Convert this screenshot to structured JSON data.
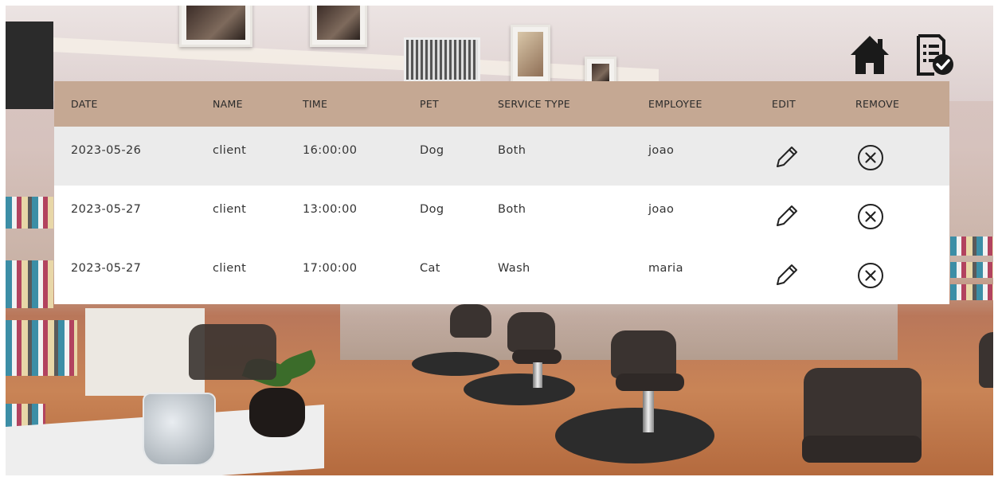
{
  "nav": {
    "home_icon": "home-icon",
    "appointments_icon": "appointment-list-check-icon"
  },
  "colors": {
    "header_bg": "#c5a893",
    "row_odd_bg": "#ebebeb",
    "row_even_bg": "#ffffff",
    "text": "#333333"
  },
  "table": {
    "columns": [
      "DATE",
      "NAME",
      "TIME",
      "PET",
      "SERVICE TYPE",
      "EMPLOYEE",
      "EDIT",
      "REMOVE"
    ],
    "rows": [
      {
        "date": "2023-05-26",
        "name": "client",
        "time": "16:00:00",
        "pet": "Dog",
        "service": "Both",
        "employee": "joao",
        "edit_icon": "pencil-icon",
        "remove_icon": "circle-x-icon"
      },
      {
        "date": "2023-05-27",
        "name": "client",
        "time": "13:00:00",
        "pet": "Dog",
        "service": "Both",
        "employee": "joao",
        "edit_icon": "pencil-icon",
        "remove_icon": "circle-x-icon"
      },
      {
        "date": "2023-05-27",
        "name": "client",
        "time": "17:00:00",
        "pet": "Cat",
        "service": "Wash",
        "employee": "maria",
        "edit_icon": "pencil-icon",
        "remove_icon": "circle-x-icon"
      }
    ]
  }
}
